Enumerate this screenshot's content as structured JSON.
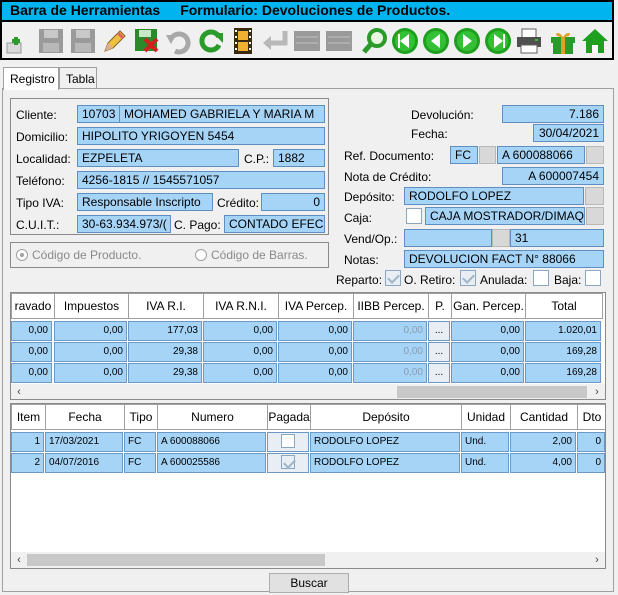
{
  "window": {
    "title": "Barra de Herramientas",
    "subtitle": "Formulario: Devoluciones de Productos."
  },
  "tabs": [
    {
      "label": "Registro"
    },
    {
      "label": "Tabla"
    }
  ],
  "form": {
    "cliente_label": "Cliente:",
    "cliente_code": "10703",
    "cliente_name": "MOHAMED GABRIELA Y MARIA M",
    "domicilio_label": "Domicilio:",
    "domicilio": "HIPOLITO YRIGOYEN 5454",
    "localidad_label": "Localidad:",
    "localidad": "EZPELETA",
    "cp_label": "C.P.:",
    "cp": "1882",
    "telefono_label": "Teléfono:",
    "telefono": "4256-1815 // 1545571057",
    "tipo_iva_label": "Tipo IVA:",
    "tipo_iva": "Responsable Inscripto",
    "credito_label": "Crédito:",
    "credito": "0",
    "cuit_label": "C.U.I.T.:",
    "cuit": "30-63.934.973/(",
    "cpago_label": "C. Pago:",
    "cpago": "CONTADO EFEC",
    "devolucion_label": "Devolución:",
    "devolucion": "7.186",
    "fecha_label": "Fecha:",
    "fecha": "30/04/2021",
    "refdoc_label": "Ref. Documento:",
    "refdoc_type": "FC",
    "refdoc_num": "A  600088066",
    "notacred_label": "Nota de Crédito:",
    "notacred": "A  600007454",
    "deposito_label": "Depósito:",
    "deposito": "RODOLFO LOPEZ",
    "caja_label": "Caja:",
    "caja": "CAJA MOSTRADOR/DIMAQ",
    "vendop_label": "Vend/Op.:",
    "vendop": "31",
    "notas_label": "Notas:",
    "notas": "DEVOLUCION FACT N° 88066",
    "reparto_label": "Reparto:",
    "oretiro_label": "O. Retiro:",
    "anulada_label": "Anulada:",
    "baja_label": "Baja:"
  },
  "radios": {
    "codigo_producto": "Código de Producto.",
    "codigo_barras": "Código de Barras."
  },
  "grid1": {
    "headers": [
      "ravado",
      "Impuestos",
      "IVA R.I.",
      "IVA R.N.I.",
      "IVA Percep.",
      "IIBB Percep.",
      "P.",
      "Gan. Percep.",
      "Total"
    ],
    "rows": [
      [
        "0,00",
        "0,00",
        "177,03",
        "0,00",
        "0,00",
        "0,00",
        "...",
        "0,00",
        "1.020,01"
      ],
      [
        "0,00",
        "0,00",
        "29,38",
        "0,00",
        "0,00",
        "0,00",
        "...",
        "0,00",
        "169,28"
      ],
      [
        "0,00",
        "0,00",
        "29,38",
        "0,00",
        "0,00",
        "0,00",
        "...",
        "0,00",
        "169,28"
      ]
    ]
  },
  "grid2": {
    "headers": [
      "Item",
      "Fecha",
      "Tipo",
      "Numero",
      "Pagada",
      "Depósito",
      "Unidad",
      "Cantidad",
      "Dto"
    ],
    "rows": [
      [
        "1",
        "17/03/2021",
        "FC",
        "A  600088066",
        "",
        "RODOLFO LOPEZ",
        "Und.",
        "2,00",
        "0"
      ],
      [
        "2",
        "04/07/2016",
        "FC",
        "A  600025586",
        "",
        "RODOLFO LOPEZ",
        "Und.",
        "4,00",
        "0"
      ]
    ]
  },
  "buttons": {
    "buscar": "Buscar"
  },
  "colors": {
    "title": "#00b4f0",
    "field": "#a6d4f7",
    "green": "#1ea01e"
  }
}
